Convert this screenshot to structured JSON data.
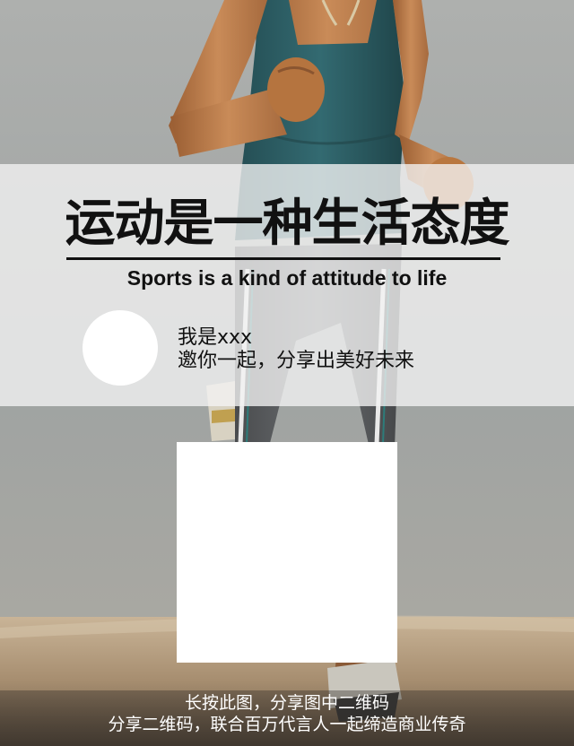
{
  "poster": {
    "headline": "运动是一种生活态度",
    "subtitle": "Sports is a kind of attitude to life"
  },
  "invite": {
    "name_line": "我是xxx",
    "message_line": "邀你一起，分享出美好未来"
  },
  "footer": {
    "line1": "长按此图，分享图中二维码",
    "line2": "分享二维码，联合百万代言人一起缔造商业传奇"
  },
  "colors": {
    "sky": "#a4a8a6",
    "ground": "#b8a183",
    "tank_top": "#2f5f66",
    "leggings": "#585b5d",
    "skin": "#b97a4a",
    "band": "#f4f4f4",
    "text": "#111111"
  }
}
